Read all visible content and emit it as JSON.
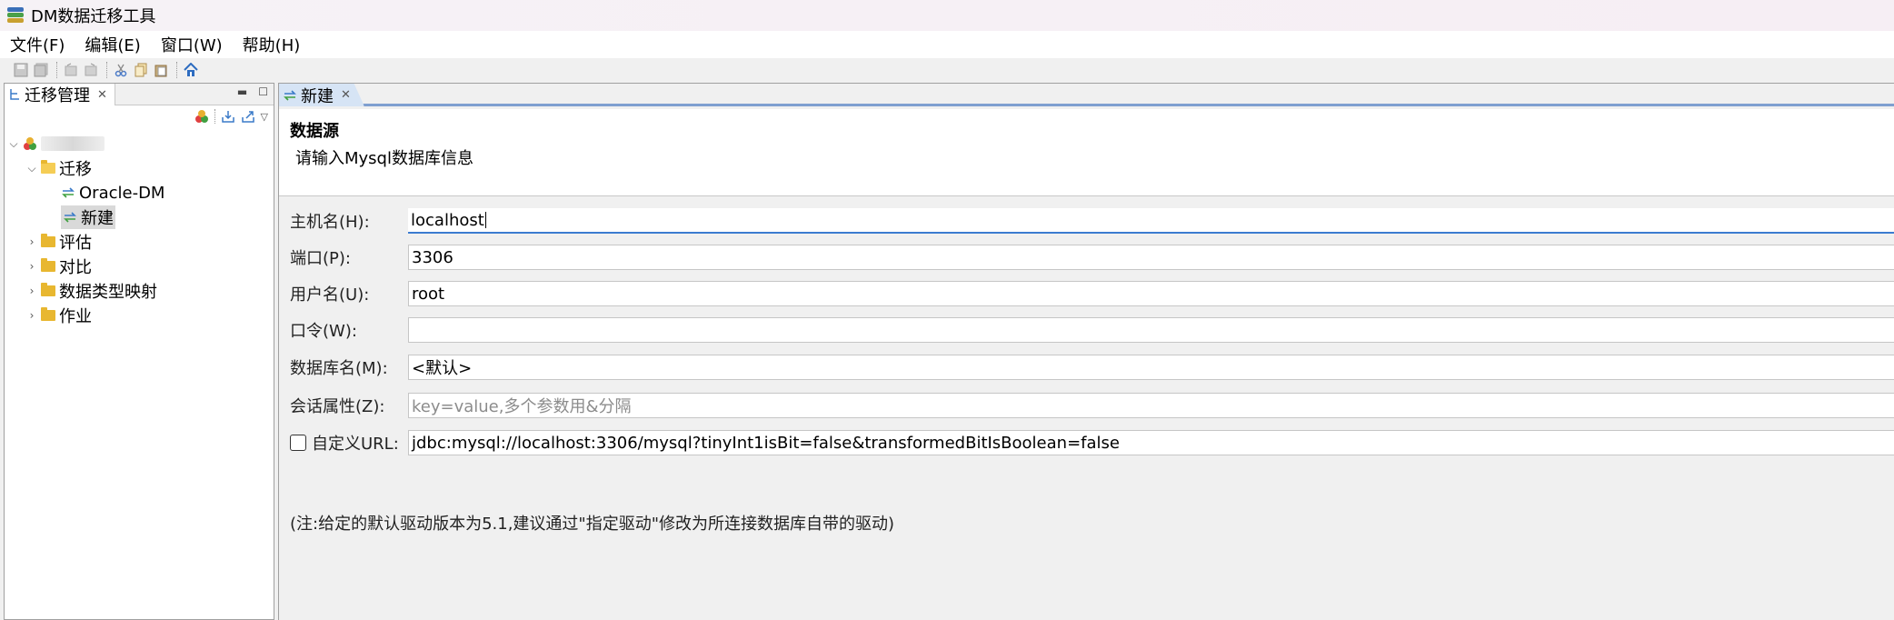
{
  "window": {
    "title": "DM数据迁移工具"
  },
  "menu": [
    "文件(F)",
    "编辑(E)",
    "窗口(W)",
    "帮助(H)"
  ],
  "toolbar": {
    "icons": [
      "save-icon",
      "save-all-icon",
      "undo-icon",
      "redo-icon",
      "cut-icon",
      "copy-icon",
      "paste-icon",
      "home-icon"
    ]
  },
  "left_panel": {
    "tab_label": "迁移管理",
    "tree": {
      "root_label": "",
      "migration_folder": "迁移",
      "migration_items": [
        "Oracle-DM",
        "新建"
      ],
      "folders": [
        "评估",
        "对比",
        "数据类型映射",
        "作业"
      ]
    }
  },
  "editor": {
    "tab_label": "新建",
    "section_title": "数据源",
    "section_subtitle": "请输入Mysql数据库信息",
    "fields": {
      "host": {
        "label": "主机名(H):",
        "value": "localhost"
      },
      "port": {
        "label": "端口(P):",
        "value": "3306"
      },
      "user": {
        "label": "用户名(U):",
        "value": "root"
      },
      "password": {
        "label": "口令(W):",
        "value": ""
      },
      "database": {
        "label": "数据库名(M):",
        "value": "<默认>"
      },
      "session": {
        "label": "会话属性(Z):",
        "placeholder": "key=value,多个参数用&分隔"
      },
      "custom_url": {
        "label": "自定义URL:",
        "checked": false,
        "value": "jdbc:mysql://localhost:3306/mysql?tinyInt1isBit=false&transformedBitIsBoolean=false"
      }
    },
    "note": "(注:给定的默认驱动版本为5.1,建议通过\"指定驱动\"修改为所连接数据库自带的驱动)"
  },
  "colors": {
    "accent": "#3b7bd0",
    "folder": "#e8b730",
    "tab_active": "#d6e4f5"
  }
}
